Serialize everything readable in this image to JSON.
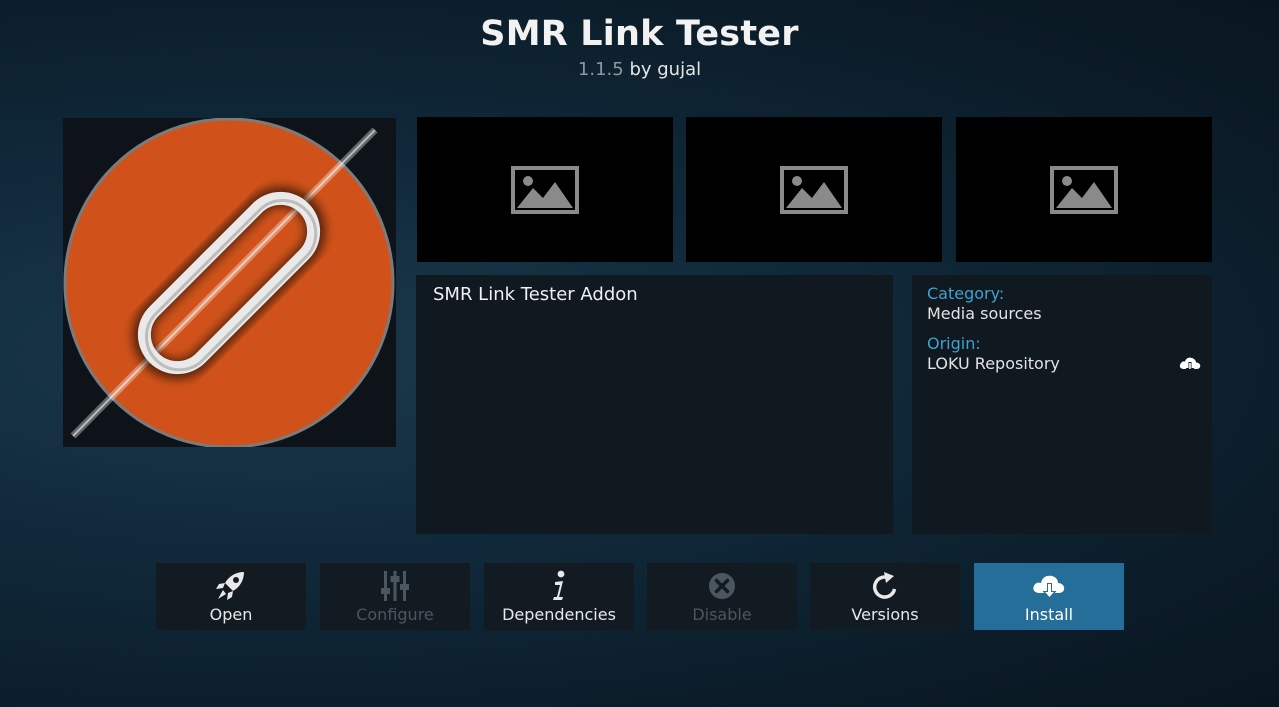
{
  "header": {
    "title": "SMR Link Tester",
    "version": "1.1.5",
    "author_text": "by gujal"
  },
  "icon": {
    "name": "chain-link-icon",
    "accent": "#d0521a"
  },
  "screenshots": [
    {
      "name": "screenshot-placeholder-1",
      "icon": "image-placeholder-icon"
    },
    {
      "name": "screenshot-placeholder-2",
      "icon": "image-placeholder-icon"
    },
    {
      "name": "screenshot-placeholder-3",
      "icon": "image-placeholder-icon"
    }
  ],
  "description": {
    "text": "SMR Link Tester Addon"
  },
  "details": {
    "category_label": "Category:",
    "category_value": "Media sources",
    "origin_label": "Origin:",
    "origin_value": "LOKU Repository",
    "origin_icon": "cloud-download-icon"
  },
  "buttons": [
    {
      "label": "Open",
      "icon": "rocket-icon",
      "enabled": true
    },
    {
      "label": "Configure",
      "icon": "sliders-icon",
      "enabled": false
    },
    {
      "label": "Dependencies",
      "icon": "info-icon",
      "enabled": true
    },
    {
      "label": "Disable",
      "icon": "close-circle-icon",
      "enabled": false
    },
    {
      "label": "Versions",
      "icon": "refresh-icon",
      "enabled": true
    },
    {
      "label": "Install",
      "icon": "cloud-download-icon",
      "enabled": true,
      "focused": true
    }
  ],
  "colors": {
    "accent_blue": "#3fa0d2",
    "focused_button": "#246e99",
    "disabled_text": "#4c565e"
  }
}
